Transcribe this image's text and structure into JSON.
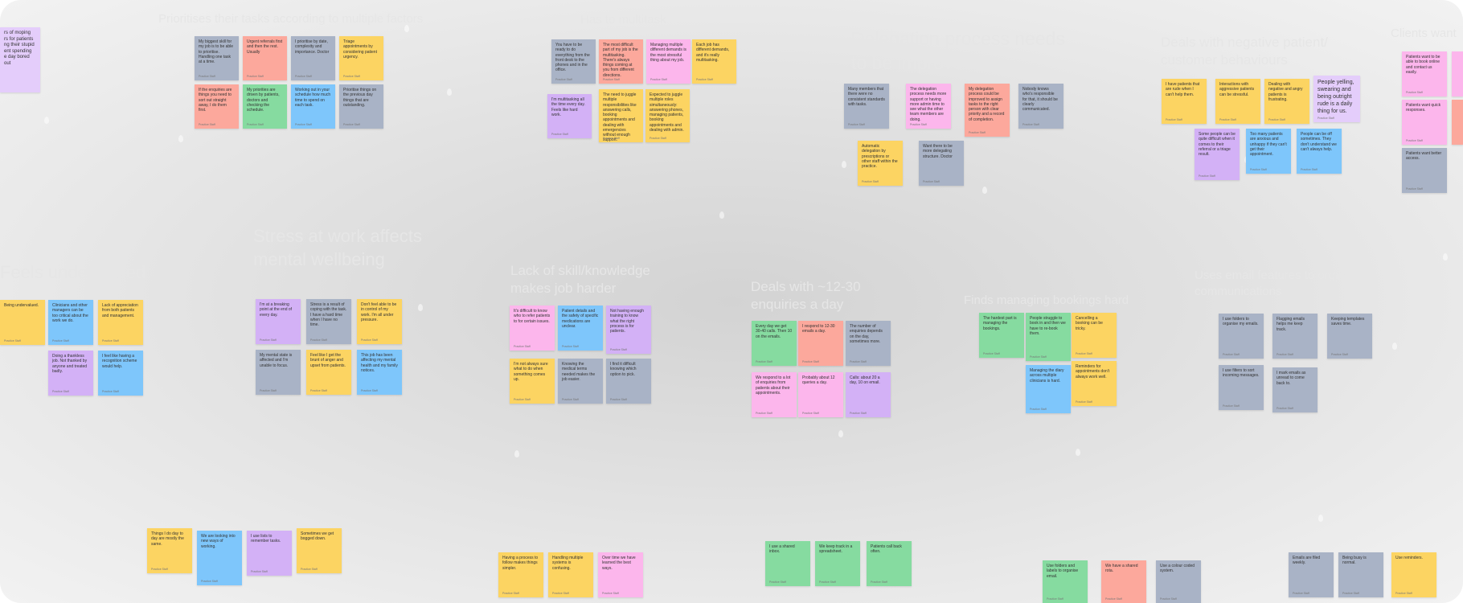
{
  "board": {
    "clusters": [
      {
        "id": "prioritises",
        "title": "Prioritises their tasks according to multiple factors"
      },
      {
        "id": "multitask",
        "title": "Has to multitask"
      },
      {
        "id": "delegation",
        "title": "Delegation process needs\nto be improved"
      },
      {
        "id": "negative",
        "title": "Deals with negative patient/\ncustomer behaviours"
      },
      {
        "id": "clients",
        "title": "Clients want"
      },
      {
        "id": "undervalued",
        "title": "Feels undervalued"
      },
      {
        "id": "stress",
        "title": "Stress at work affects\nmental wellbeing"
      },
      {
        "id": "skill",
        "title": "Lack of skill/knowledge\nmakes job harder"
      },
      {
        "id": "enquiries",
        "title": "Deals with ~12-30\nenquiries a day"
      },
      {
        "id": "bookings",
        "title": "Finds managing bookings hard"
      },
      {
        "id": "email",
        "title": "Uses email features to organise\ncommunications"
      }
    ],
    "notes": {
      "n_left": {
        "text": "rs of moping\nrs for patients\nng their stupid\nent spending\ne day bored out",
        "author": ""
      },
      "p1": {
        "text": "My biggest skill for my job is to be able to prioritise. Handling one task at a time.",
        "author": "Practice Staff"
      },
      "p2": {
        "text": "Urgent referrals first and then the rest. Usually",
        "author": "Practice Staff"
      },
      "p3": {
        "text": "I prioritise by date, complexity and importance. Doctor",
        "author": "Practice Staff"
      },
      "p4": {
        "text": "Triage appointments by considering patient urgency.",
        "author": "Practice Staff"
      },
      "p5": {
        "text": "If the enquiries are things you need to sort out straight away, I do them first.",
        "author": "Practice Staff"
      },
      "p6": {
        "text": "My priorities are driven by patients, doctors and checking the schedule.",
        "author": "Practice Staff"
      },
      "p7": {
        "text": "Working out in your schedule how much time to spend on each task.",
        "author": "Practice Staff"
      },
      "p8": {
        "text": "Prioritise things on the previous day things that are outstanding.",
        "author": "Practice Staff"
      },
      "m1": {
        "text": "You have to be ready to do everything from the front desk to the phones and in the office.",
        "author": "Practice Staff"
      },
      "m2": {
        "text": "The most difficult part of my job is the multitasking. There's always things coming at you from different directions.",
        "author": "Practice Staff"
      },
      "m3": {
        "text": "Managing multiple different demands is the most stressful thing about my job.",
        "author": "Practice Staff"
      },
      "m4": {
        "text": "Each job has different demands, and it's really multitasking.",
        "author": "Practice Staff"
      },
      "m5": {
        "text": "I'm multitasking all the time every day. Feels like hard work.",
        "author": "Practice Staff"
      },
      "m6": {
        "text": "The need to juggle multiple responsibilities like answering calls, booking appointments and dealing with emergencies without enough support.",
        "author": "Practice Staff"
      },
      "m7": {
        "text": "Expected to juggle multiple roles simultaneously: answering phones, managing patients, booking appointments and dealing with admin.",
        "author": "Practice Staff"
      },
      "d1": {
        "text": "Many members that there were no consistent standards with tasks.",
        "author": "Practice Staff"
      },
      "d2": {
        "text": "The delegation process needs more support or having more admin time to see what the other team members are doing.",
        "author": "Practice Staff"
      },
      "d3": {
        "text": "My delegation process could be improved to assign tasks to the right person with clear priority and a record of completion.",
        "author": "Practice Staff"
      },
      "d4": {
        "text": "Nobody knows who's responsible for that, it should be clearly communicated.",
        "author": "Practice Staff"
      },
      "d5": {
        "text": "Automatic delegation by prescriptions or other staff within the practice.",
        "author": "Practice Staff"
      },
      "d6": {
        "text": "Want there to be more delegating structure. Doctor",
        "author": "Practice Staff"
      },
      "ng1": {
        "text": "I have patients that are rude when I can't help them.",
        "author": "Practice Staff"
      },
      "ng2": {
        "text": "Interactions with aggressive patients can be stressful.",
        "author": "Practice Staff"
      },
      "ng3": {
        "text": "Dealing with negative and angry patients is frustrating.",
        "author": "Practice Staff"
      },
      "ng4": {
        "text": "People yelling, swearing and being outright rude is a daily thing for us.",
        "author": "Practice Staff"
      },
      "ng5": {
        "text": "Some people can be quite difficult when it comes to their referral or a triage result.",
        "author": "Practice Staff"
      },
      "ng6": {
        "text": "Too many patients are anxious and unhappy if they can't get their appointment.",
        "author": "Practice Staff"
      },
      "ng7": {
        "text": "People can be off sometimes. They don't understand we can't always help.",
        "author": "Practice Staff"
      },
      "c1": {
        "text": "Patients want to be able to book online and contact us easily.",
        "author": "Practice Staff"
      },
      "c2": {
        "text": "Patients want quick responses.",
        "author": "Practice Staff"
      },
      "c3": {
        "text": "Patients want better access.",
        "author": "Practice Staff"
      },
      "u1": {
        "text": "Being undervalued.",
        "author": "Practice Staff"
      },
      "u2": {
        "text": "Clinicians and other managers can be too critical about the work we do.",
        "author": "Practice Staff"
      },
      "u3": {
        "text": "Lack of appreciation from both patients and management.",
        "author": "Practice Staff"
      },
      "u4": {
        "text": "Doing a thankless job. Not thanked by anyone and treated badly.",
        "author": "Practice Staff"
      },
      "u5": {
        "text": "I feel like having a recognition scheme would help.",
        "author": "Practice Staff"
      },
      "s1": {
        "text": "I'm at a breaking point at the end of every day.",
        "author": "Practice Staff"
      },
      "s2": {
        "text": "Stress is a result of coping with the task. I have a hard time when I have no time.",
        "author": "Practice Staff"
      },
      "s3": {
        "text": "Don't feel able to be in control of my work. I'm all under pressure.",
        "author": "Practice Staff"
      },
      "s4": {
        "text": "My mental state is affected and I'm unable to focus.",
        "author": "Practice Staff"
      },
      "s5": {
        "text": "Feel like I get the brunt of anger and upset from patients.",
        "author": "Practice Staff"
      },
      "s6": {
        "text": "This job has been affecting my mental health and my family notices.",
        "author": "Practice Staff"
      },
      "k1": {
        "text": "It's difficult to know who to refer patients to for certain issues.",
        "author": "Practice Staff"
      },
      "k2": {
        "text": "Patient details and the safety of specific medications are unclear.",
        "author": "Practice Staff"
      },
      "k3": {
        "text": "Not having enough training to know what the right process is for patients.",
        "author": "Practice Staff"
      },
      "k4": {
        "text": "I'm not always sure what to do when something comes up.",
        "author": "Practice Staff"
      },
      "k5": {
        "text": "Knowing the medical terms needed makes the job easier.",
        "author": "Practice Staff"
      },
      "k6": {
        "text": "I find it difficult knowing which option to pick.",
        "author": "Practice Staff"
      },
      "q1": {
        "text": "Every day we get 30-40 calls. Then 10 on the emails.",
        "author": "Practice Staff"
      },
      "q2": {
        "text": "I respond to 12-30 emails a day.",
        "author": "Practice Staff"
      },
      "q3": {
        "text": "The number of enquiries depends on the day, sometimes more.",
        "author": "Practice Staff"
      },
      "q4": {
        "text": "We respond to a lot of enquiries from patients about their appointments.",
        "author": "Practice Staff"
      },
      "q5": {
        "text": "Probably about 12 queries a day.",
        "author": "Practice Staff"
      },
      "q6": {
        "text": "Calls: about 20 a day, 10 on email.",
        "author": "Practice Staff"
      },
      "bk1": {
        "text": "The hardest part is managing the bookings.",
        "author": "Practice Staff"
      },
      "bk2": {
        "text": "People struggle to book in and then we have to re-book them.",
        "author": "Practice Staff"
      },
      "bk3": {
        "text": "Cancelling a booking can be tricky.",
        "author": "Practice Staff"
      },
      "bk4": {
        "text": "Managing the diary across multiple clinicians is hard.",
        "author": "Practice Staff"
      },
      "bk5": {
        "text": "Reminders for appointments don't always work well.",
        "author": "Practice Staff"
      },
      "em1": {
        "text": "I use folders to organise my emails.",
        "author": "Practice Staff"
      },
      "em2": {
        "text": "Flagging emails helps me keep track.",
        "author": "Practice Staff"
      },
      "em3": {
        "text": "I use filters to sort incoming messages.",
        "author": "Practice Staff"
      },
      "em4": {
        "text": "I mark emails as unread to come back to.",
        "author": "Practice Staff"
      },
      "em5": {
        "text": "Keeping templates saves time.",
        "author": "Practice Staff"
      },
      "x1": {
        "text": "Things I do day to day are mostly the same.",
        "author": "Practice Staff"
      },
      "x2": {
        "text": "We are looking into new ways of working.",
        "author": "Practice Staff"
      },
      "x3": {
        "text": "I use lists to remember tasks.",
        "author": "Practice Staff"
      },
      "x4": {
        "text": "Sometimes we get bogged down.",
        "author": "Practice Staff"
      },
      "x5": {
        "text": "Having a process to follow makes things simpler.",
        "author": "Practice Staff"
      },
      "x6": {
        "text": "Handling multiple systems is confusing.",
        "author": "Practice Staff"
      },
      "x7": {
        "text": "Over time we have learned the best ways.",
        "author": "Practice Staff"
      },
      "x8": {
        "text": "I use a shared inbox.",
        "author": "Practice Staff"
      },
      "x9": {
        "text": "We keep track in a spreadsheet.",
        "author": "Practice Staff"
      },
      "x10": {
        "text": "Patients call back often.",
        "author": "Practice Staff"
      },
      "x11": {
        "text": "Use folders and labels to organise email.",
        "author": "Practice Staff"
      },
      "x12": {
        "text": "We have a shared rota.",
        "author": "Practice Staff"
      },
      "x13": {
        "text": "Use a colour coded system.",
        "author": "Practice Staff"
      },
      "x14": {
        "text": "Emails are filed weekly.",
        "author": "Practice Staff"
      },
      "x15": {
        "text": "Being busy is normal.",
        "author": "Practice Staff"
      },
      "x16": {
        "text": "Use reminders.",
        "author": "Practice Staff"
      }
    }
  },
  "colors": {
    "yellow": "#fcd462",
    "grey": "#a9b3c6",
    "pink": "#fcb6ec",
    "salmon": "#fca89c",
    "green": "#86dba0",
    "blue": "#7ec6fb",
    "violet": "#d3b1f6",
    "lilac": "#e4cdfb"
  }
}
